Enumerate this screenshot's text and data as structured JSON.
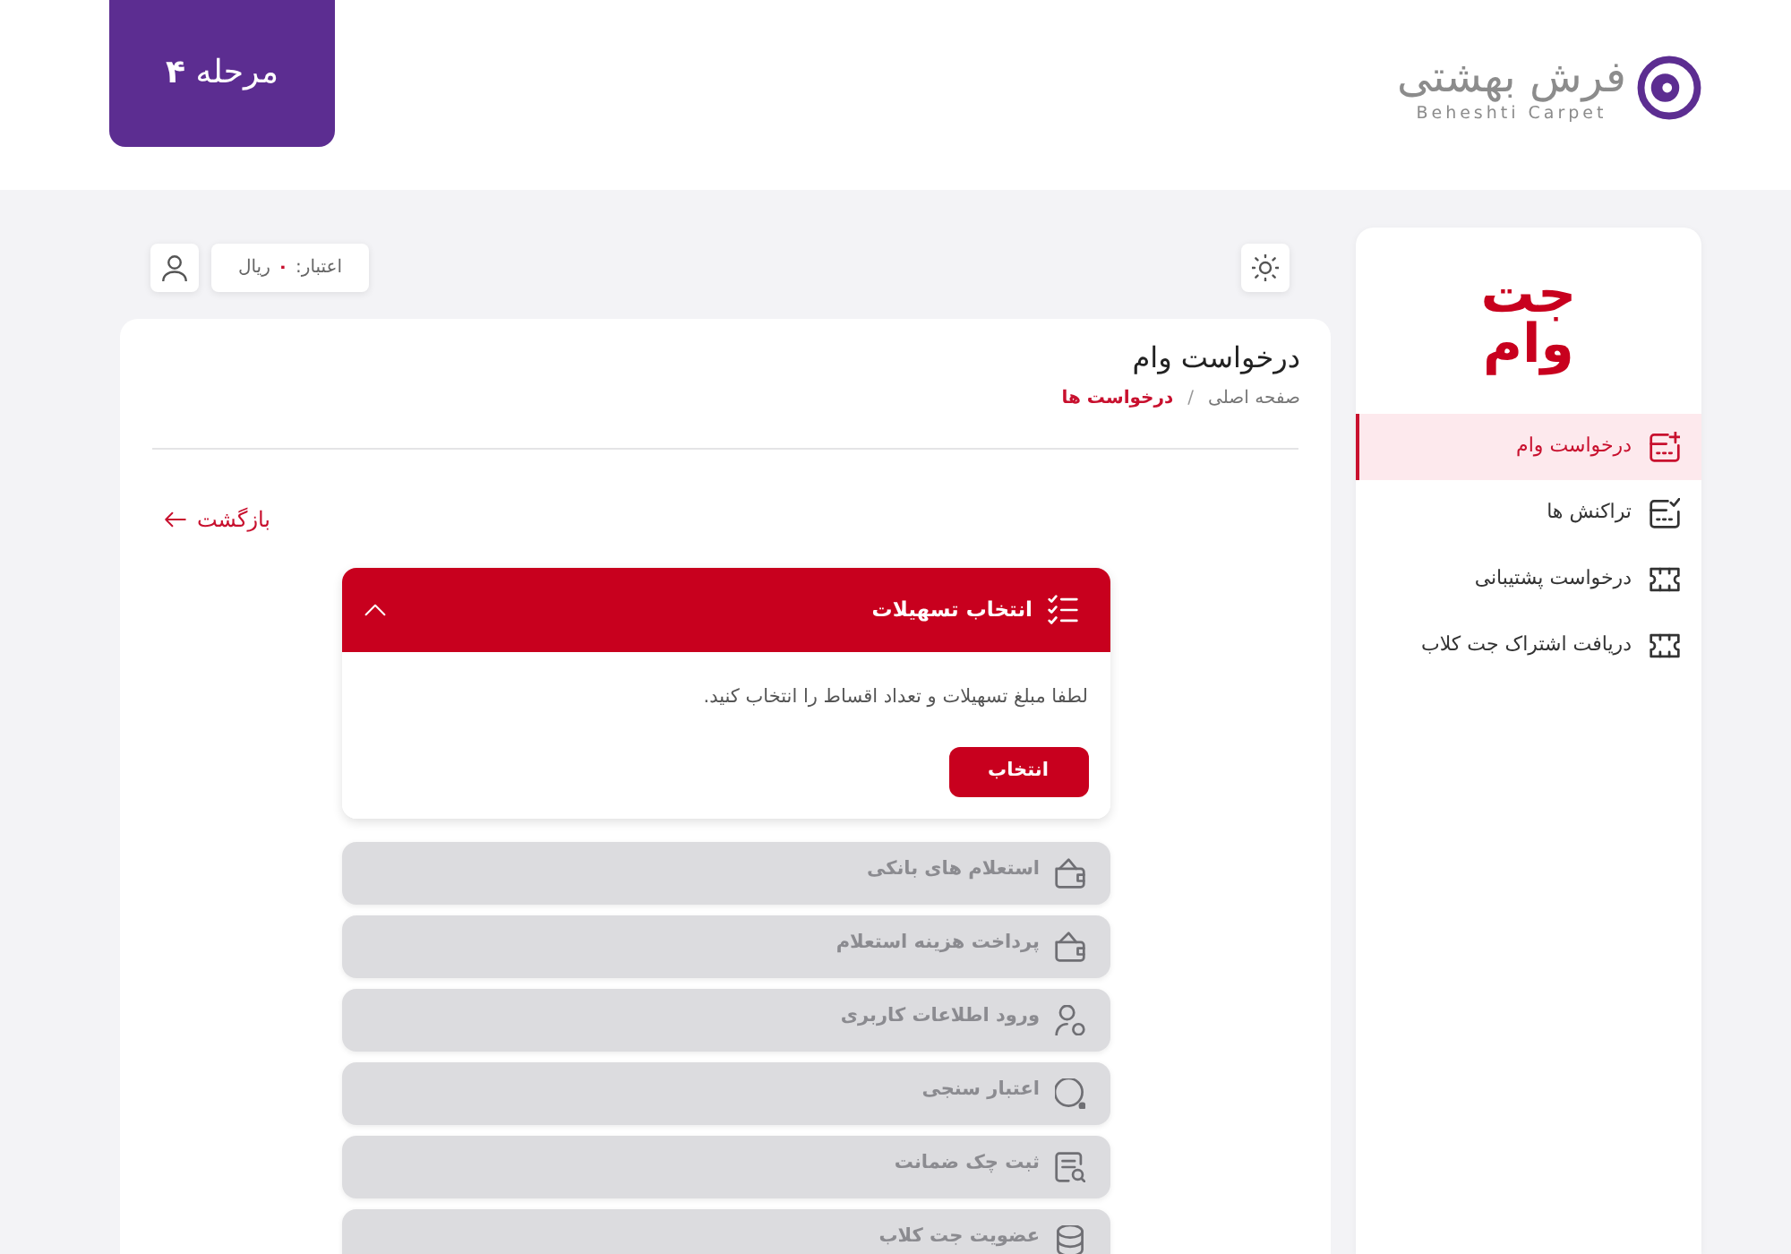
{
  "header": {
    "logo": {
      "name": "فرش بهشتی",
      "latin": "Beheshti Carpet"
    },
    "stage_badge": "مرحله **۴**"
  },
  "sidebar": {
    "brand": "جت وام",
    "items": [
      {
        "label": "درخواست وام",
        "selected": true
      },
      {
        "label": "تراکنش ها",
        "selected": false
      },
      {
        "label": "درخواست پشتیبانی",
        "selected": false
      },
      {
        "label": "دریافت اشتراک جت کلاب",
        "selected": false
      }
    ]
  },
  "toolbar": {
    "credit": {
      "label": "اعتبار:",
      "amount": "۰",
      "unit": "ریال"
    }
  },
  "page": {
    "title": "درخواست وام",
    "breadcrumb": {
      "separator": "/",
      "items": [
        {
          "label": "صفحه اصلی",
          "current": false
        },
        {
          "label": "درخواست ها",
          "current": true
        }
      ]
    },
    "back_link": "بازگشت"
  },
  "steps": [
    {
      "title": "انتخاب تسهیلات",
      "expanded": true,
      "disabled": false,
      "body": {
        "text": "لطفا مبلغ تسهیلات و تعداد اقساط را انتخاب کنید.",
        "button": "انتخاب"
      }
    },
    {
      "title": "استعلام های بانکی",
      "expanded": false,
      "disabled": true
    },
    {
      "title": "پرداخت هزینه استعلام",
      "expanded": false,
      "disabled": true
    },
    {
      "title": "ورود اطلاعات کاربری",
      "expanded": false,
      "disabled": true
    },
    {
      "title": "اعتبار سنجی",
      "expanded": false,
      "disabled": true
    },
    {
      "title": "ثبت چک ضمانت",
      "expanded": false,
      "disabled": true
    },
    {
      "title": "عضویت جت کلاب",
      "expanded": false,
      "disabled": true
    }
  ]
}
